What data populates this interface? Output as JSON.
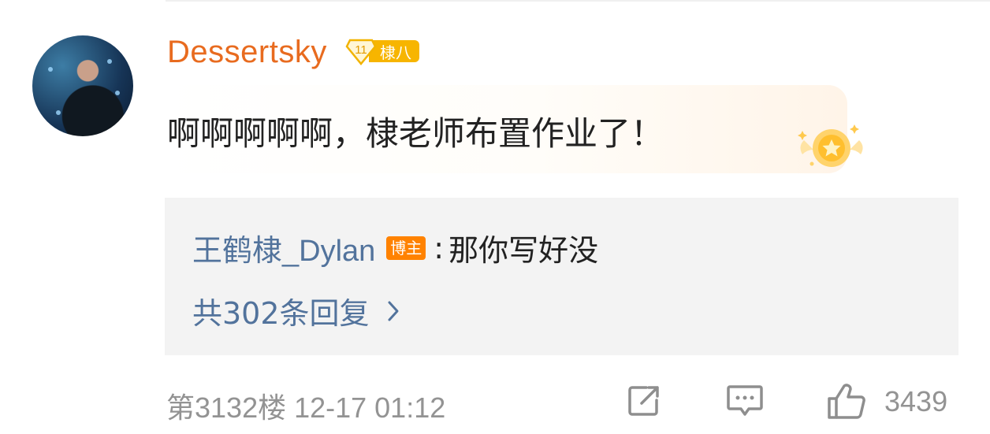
{
  "comment": {
    "username": "Dessertsky",
    "level": "11",
    "level_tag": "棣八",
    "text": "啊啊啊啊啊，棣老师布置作业了！"
  },
  "reply_preview": {
    "author": "王鹤棣_Dylan",
    "author_badge": "博主",
    "colon": ":",
    "text": "那你写好没",
    "count_label": "共302条回复"
  },
  "footer": {
    "floor_time": "第3132楼 12-17 01:12",
    "like_count": "3439"
  },
  "colors": {
    "username": "#e86b1f",
    "link_blue": "#52739c",
    "badge_orange": "#ff8200",
    "level_yellow": "#f7b500",
    "meta_gray": "#939393"
  }
}
